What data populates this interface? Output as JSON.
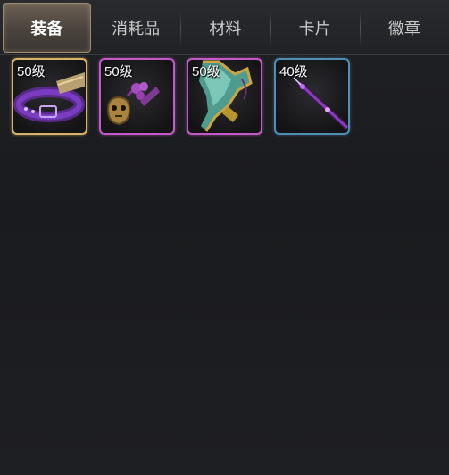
{
  "tabs": [
    {
      "label": "装备",
      "active": true
    },
    {
      "label": "消耗品",
      "active": false
    },
    {
      "label": "材料",
      "active": false
    },
    {
      "label": "卡片",
      "active": false
    },
    {
      "label": "徽章",
      "active": false
    }
  ],
  "items": [
    {
      "level": "50级",
      "icon": "purple-belt-icon",
      "quality_color": "#d8b36a"
    },
    {
      "level": "50级",
      "icon": "mask-charm-icon",
      "quality_color": "#c25ac7"
    },
    {
      "level": "50级",
      "icon": "jade-blade-icon",
      "quality_color": "#c25ac7"
    },
    {
      "level": "40级",
      "icon": "purple-wand-icon",
      "quality_color": "#4f8fb4"
    }
  ]
}
